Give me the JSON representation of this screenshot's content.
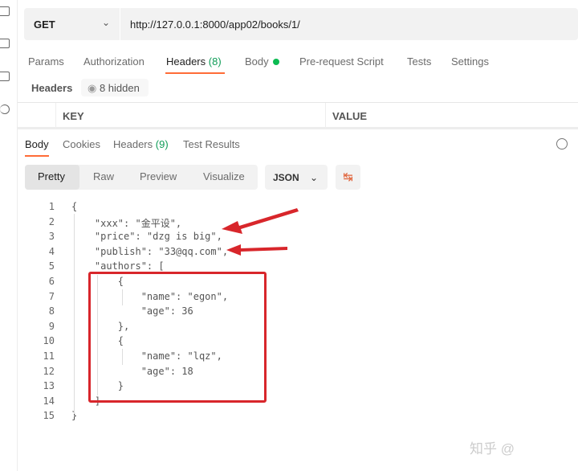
{
  "sidebar": {
    "icons": [
      "api-icon",
      "collection-icon",
      "monitor-icon",
      "history-icon"
    ]
  },
  "request": {
    "method": "GET",
    "url": "http://127.0.0.1:8000/app02/books/1/"
  },
  "request_tabs": [
    {
      "label": "Params"
    },
    {
      "label": "Authorization"
    },
    {
      "label": "Headers",
      "count": "(8)",
      "active": true
    },
    {
      "label": "Body",
      "status": "green-dot"
    },
    {
      "label": "Pre-request Script"
    },
    {
      "label": "Tests"
    },
    {
      "label": "Settings"
    }
  ],
  "headers_section": {
    "label": "Headers",
    "hidden": "8 hidden",
    "columns": [
      "KEY",
      "VALUE"
    ]
  },
  "response_tabs": [
    {
      "label": "Body",
      "active": true
    },
    {
      "label": "Cookies"
    },
    {
      "label": "Headers",
      "count": "(9)"
    },
    {
      "label": "Test Results"
    }
  ],
  "format_tabs": [
    "Pretty",
    "Raw",
    "Preview",
    "Visualize"
  ],
  "format_select": "JSON",
  "code": {
    "line_numbers": [
      "1",
      "2",
      "3",
      "4",
      "5",
      "6",
      "7",
      "8",
      "9",
      "10",
      "11",
      "12",
      "13",
      "14",
      "15"
    ],
    "lines": [
      "{",
      "    \"xxx\": \"金平设\",",
      "    \"price\": \"dzg is big\",",
      "    \"publish\": \"33@qq.com\",",
      "    \"authors\": [",
      "        {",
      "            \"name\": \"egon\",",
      "            \"age\": 36",
      "        },",
      "        {",
      "            \"name\": \"lqz\",",
      "            \"age\": 18",
      "        }",
      "    ]",
      "}"
    ]
  },
  "annotation_color": "#d8262b",
  "accent": "#ff6c37",
  "watermark": "知乎 @"
}
